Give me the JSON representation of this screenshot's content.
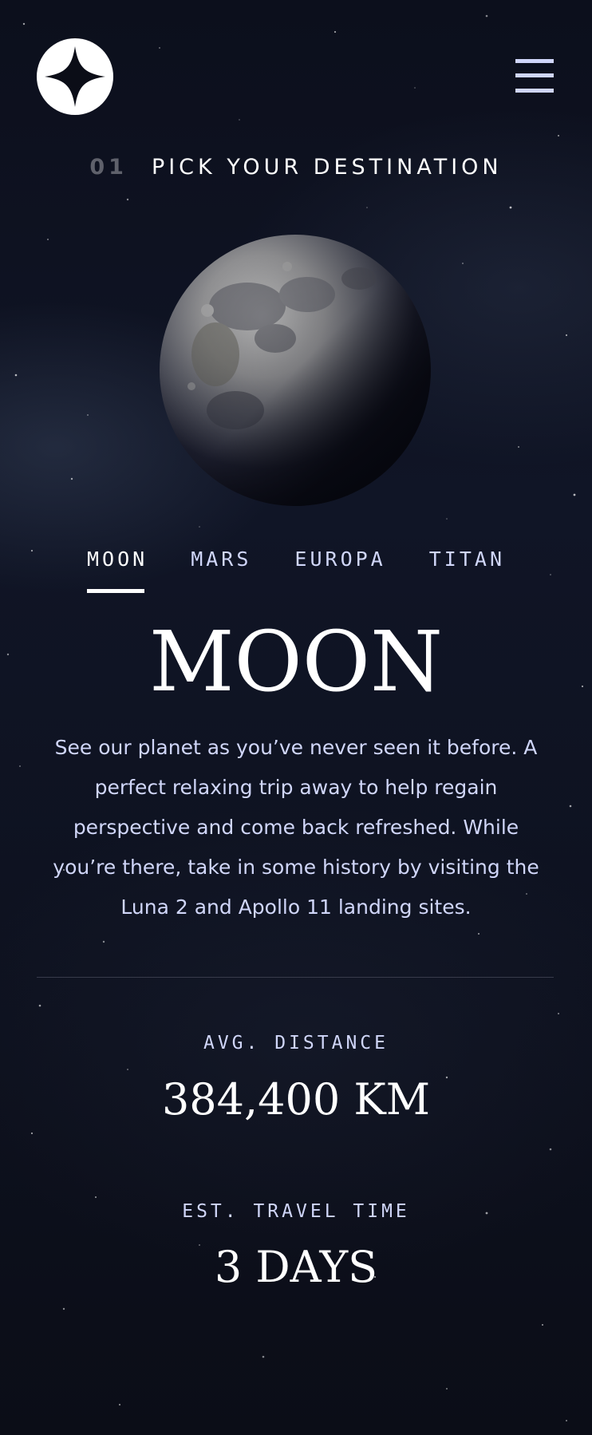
{
  "header": {
    "logo_icon": "star-logo-icon",
    "menu_icon": "hamburger-menu-icon"
  },
  "page_heading": {
    "number": "01",
    "label": "PICK YOUR DESTINATION"
  },
  "destination_image": {
    "icon": "moon-image"
  },
  "tabs": [
    {
      "label": "MOON",
      "active": true
    },
    {
      "label": "MARS",
      "active": false
    },
    {
      "label": "EUROPA",
      "active": false
    },
    {
      "label": "TITAN",
      "active": false
    }
  ],
  "destination": {
    "name": "MOON",
    "description": "See our planet as you’ve never seen it before. A perfect relaxing trip away to help regain perspective and come back refreshed. While you’re there, take in some history by visiting the Luna 2 and Apollo 11 landing sites."
  },
  "stats": {
    "distance_label": "AVG. DISTANCE",
    "distance_value": "384,400 KM",
    "travel_label": "EST. TRAVEL TIME",
    "travel_value": "3 DAYS"
  },
  "colors": {
    "background": "#0b0d17",
    "accent_light": "#d0d6f9",
    "white": "#ffffff",
    "muted_number": "#5f616b"
  }
}
